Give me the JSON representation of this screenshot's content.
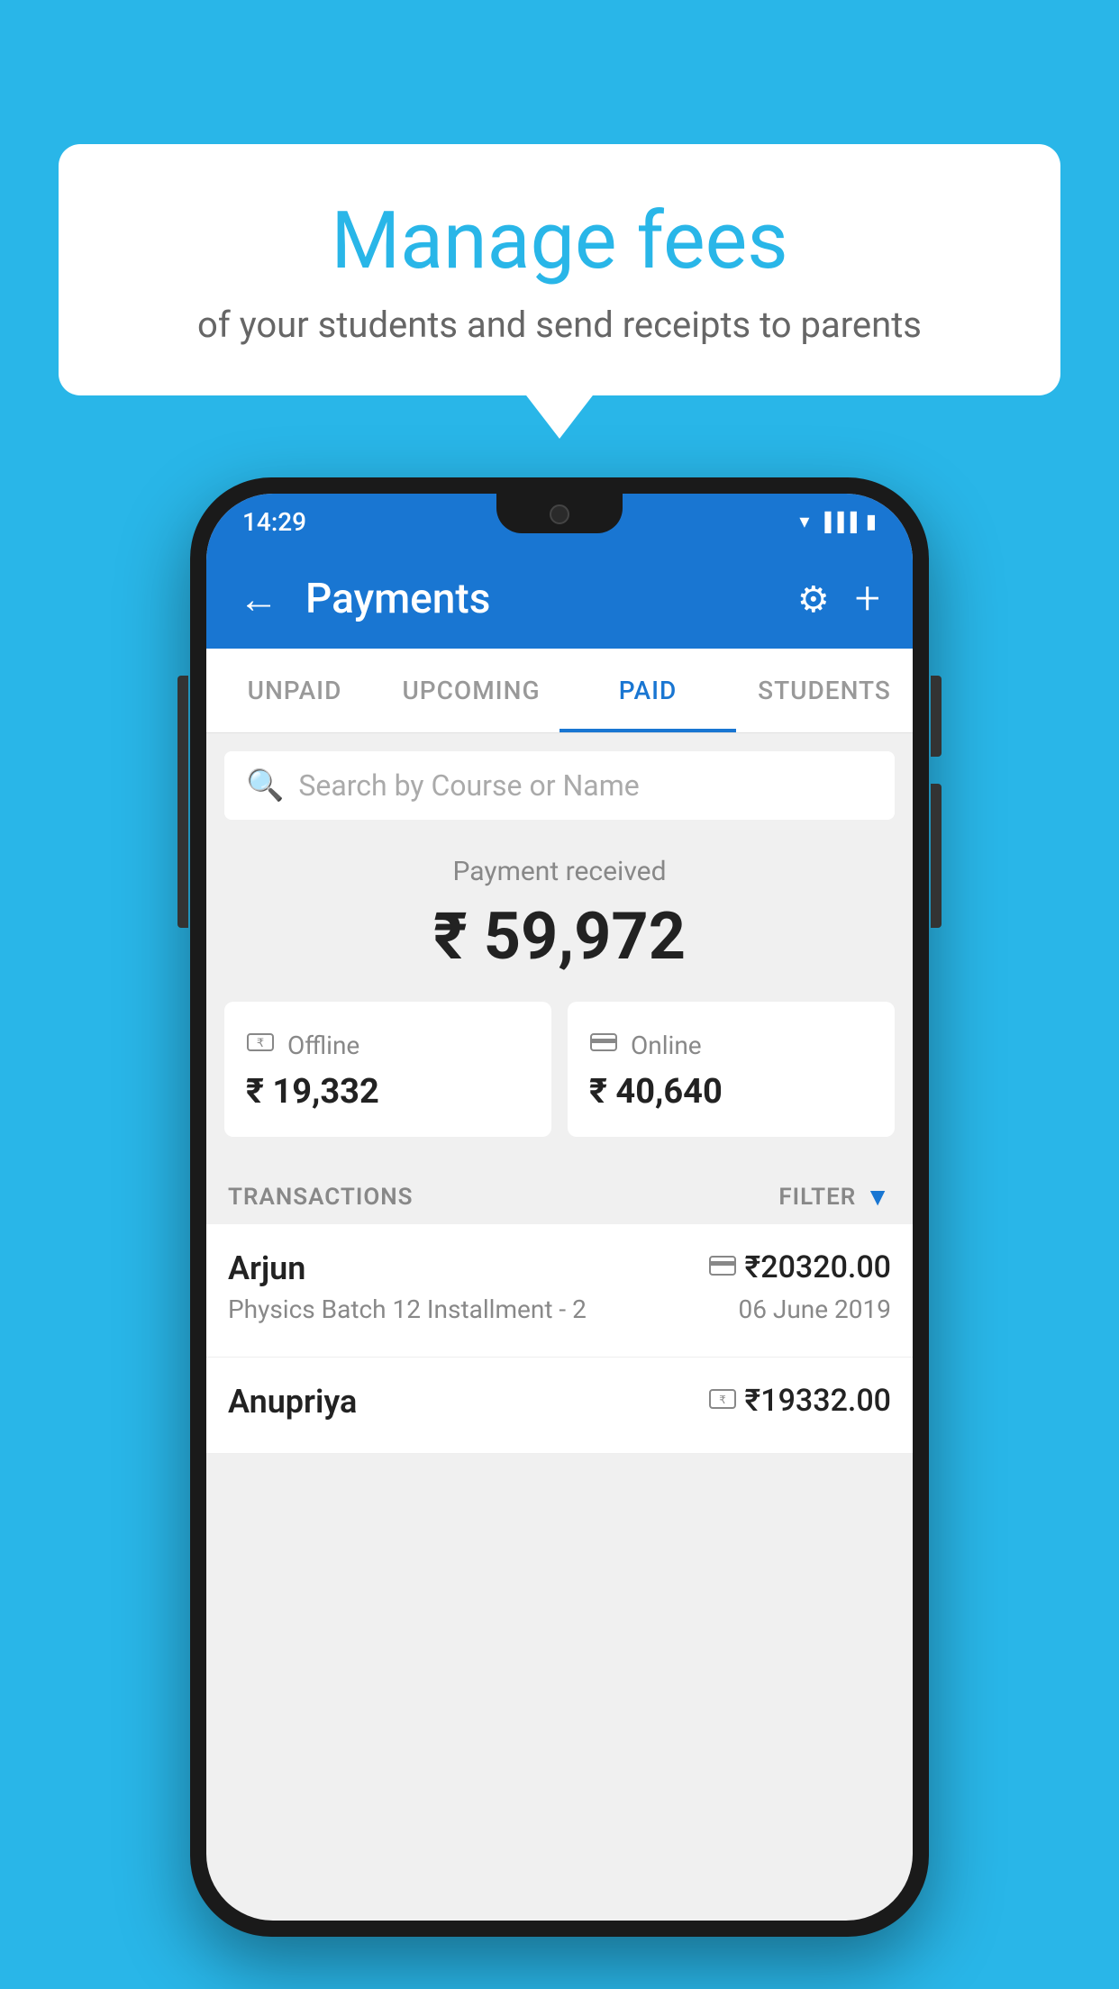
{
  "background": {
    "color": "#29b6e8"
  },
  "speech_bubble": {
    "title": "Manage fees",
    "subtitle": "of your students and send receipts to parents"
  },
  "status_bar": {
    "time": "14:29",
    "icons": [
      "wifi",
      "signal",
      "battery"
    ]
  },
  "header": {
    "title": "Payments",
    "back_label": "←",
    "settings_label": "⚙",
    "add_label": "+"
  },
  "tabs": [
    {
      "label": "UNPAID",
      "active": false
    },
    {
      "label": "UPCOMING",
      "active": false
    },
    {
      "label": "PAID",
      "active": true
    },
    {
      "label": "STUDENTS",
      "active": false
    }
  ],
  "search": {
    "placeholder": "Search by Course or Name"
  },
  "payment_summary": {
    "label": "Payment received",
    "amount": "₹ 59,972",
    "offline_label": "Offline",
    "offline_amount": "₹ 19,332",
    "online_label": "Online",
    "online_amount": "₹ 40,640"
  },
  "transactions": {
    "section_label": "TRANSACTIONS",
    "filter_label": "FILTER",
    "items": [
      {
        "name": "Arjun",
        "detail": "Physics Batch 12 Installment - 2",
        "amount": "₹20320.00",
        "date": "06 June 2019",
        "payment_type": "card"
      },
      {
        "name": "Anupriya",
        "detail": "",
        "amount": "₹19332.00",
        "date": "",
        "payment_type": "offline"
      }
    ]
  }
}
